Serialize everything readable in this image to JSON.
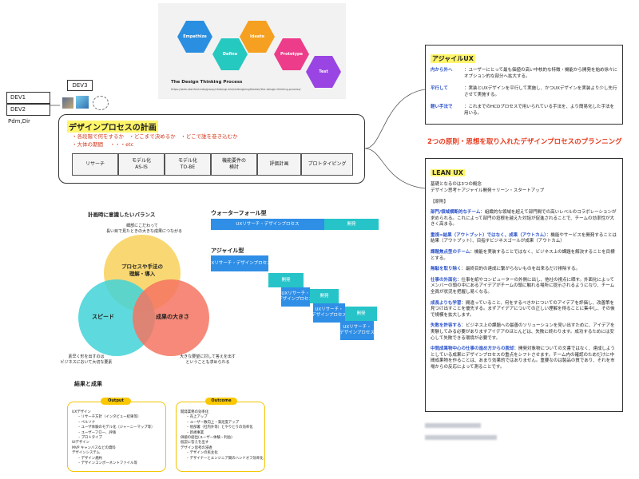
{
  "design_thinking": {
    "stages": [
      "Empathize",
      "Define",
      "Ideate",
      "Prototype",
      "Test"
    ],
    "caption": "The Design Thinking Process",
    "url": "https://web.stanford.edu/group/cilab/cgi-bin/redesigningtheater/the-design-thinking-process/"
  },
  "devs": {
    "dev1": "DEV1",
    "dev2": "DEV2",
    "dev3": "DEV3",
    "pdm": "Pdm,Dir"
  },
  "plan": {
    "title": "デザインプロセスの計画",
    "note1": "・各段階で何をするか　・どこまで決めるか　・どこで誰を巻き込むか",
    "note2": "・大体の期間　 ・・・etc",
    "steps": [
      "リサーチ",
      "モデル化\nAS-IS",
      "モデル化\nTO-BE",
      "機能要件の\n検討",
      "評価計画",
      "プロトタイピング"
    ]
  },
  "balance": {
    "title": "計画時に意識したいバランス",
    "top_note": "細部にこだわって\n長い目で見たときの大きな成果につながる",
    "circle_top": "プロセスや手法の\n理解・導入",
    "circle_left": "スピード",
    "circle_right": "成果の大きさ",
    "note_left": "素早く形を出すのは\nビジネスにおいて大切な要素",
    "note_right": "大きな要望に対して答えを出す\nということも求められる"
  },
  "waterfall": {
    "title": "ウォーターフォール型",
    "bar1": "UXリサーチ・デザインプロセス",
    "bar2": "開発"
  },
  "agile": {
    "title": "アジャイル型",
    "bars": [
      "UXリサーチ・デザインプロセス",
      "開発",
      "UXリサーチ・\nデザインプロセス",
      "開発",
      "UXリサーチ・\nデザインプロセス",
      "開発",
      "UXリサーチ・\nデザインプロセス"
    ]
  },
  "results": {
    "title": "結果と成果",
    "output_label": "Output",
    "outcome_label": "Outcome",
    "output_items": [
      "UXデザイン",
      "– リサーチ方針（インタビュー結果等）",
      "– ペルソナ",
      "– ユーザ体験のモデル化（ジャーニーマップ等）",
      "– ユーザーフロー、評価",
      "– プロトタイプ",
      "UIデザイン",
      "MVP キャンバスなどの資料",
      "デザインシステム",
      "– デザイン規約",
      "– デザインコンポーネントファイル等"
    ],
    "outcome_items": [
      "開発業務の効率化",
      "– 売上アップ",
      "– ユーザー数向上・満足度アップ",
      "– 他部署（社内外等）とやりとりの効率化",
      "– 新規事業",
      "価値の創出(ユーザー体験・利益)",
      "仮説に答えを出す",
      "デザイン思考の浸透",
      "– デザインの民主化",
      "– デザイナーとエンジニア間のハンドオフ効率化"
    ]
  },
  "agile_ux": {
    "title": "アジャイルUX",
    "rows": [
      {
        "key": "内から外へ",
        "text": "ユーザーにとって最も価値の高い中核的な特徴・機能から開発を始め徐々にオプション的な部分へ拡大する。"
      },
      {
        "key": "平行して",
        "text": "実装とUXデザインを平行して実施し、かつUXデザインを実装より少し先行させて実施する。"
      },
      {
        "key": "軽い手法で",
        "text": "これまでのHCDプロセスで用いられている手法を、より簡易化した手法を用いる。"
      }
    ]
  },
  "center_title": "2つの原則・思想を取り入れたデザインプロセスのプランニング",
  "lean_ux": {
    "title": "LEAN UX",
    "intro1": "基礎となるのは3つの概念",
    "intro2": "デザイン思考＋アジャイル開発＋リーン・スタートアップ",
    "principles_label": "【原則】",
    "rows": [
      {
        "key": "部門/領域横断的なチーム",
        "text": "：組織的な領域を超えて部門間での高いレベルのコラボレーションが求められる。これによって部門の垣根を越えた対話が促進されることで、チームの効率性が大きく高まる。"
      },
      {
        "key": "重視=結果（アウトプット）ではなく、成果（アウトカム）",
        "text": "：機能やサービスを開発することは結果（アウトプット）、目指すビジネスゴールが成果（アウトカム）"
      },
      {
        "key": "課題焦点型のチーム",
        "text": "：機能を実装することではなく、ビジネス上の課題を解決することを目標とする。"
      },
      {
        "key": "無駄を取り除く",
        "text": "：最終目的の達成に繋がらないものを出来るだけ排除する。"
      },
      {
        "key": "仕事の外面化",
        "text": "：仕事を紙やコンピューターの外側に出し、他社の視点に晒す。外面化によってメンバーの頭の中にあるアイデアがチームの頭に触れる場所に提示されるようになり、チーム全員が状況を把握し易くなる。"
      },
      {
        "key": "成長よりも学習",
        "text": "：間違っていること、何をするべきかについてのアイデアを評価し、改善策を見つけ出すことを優先する。まずアイデアについての正しい理解を得ることに集中し、その後で規模を拡大します。"
      },
      {
        "key": "失敗を許容する",
        "text": "：ビジネス上の課題への最善のソリューションを見い出すために、アイデアを実験してみる必要がありますアイデアのほとんどは、失敗に終わります。成功するためには安心して失敗できる環境が必要です。"
      },
      {
        "key": "中間成果物中心の仕事の進め方からの脱却",
        "text": "：開発対象物についての文書ではなく、達成しようとしている成果にデザインプロセスの重点をシフトさせます。チーム内の確認のためだけに中間成果物を作ることは、あまり効果的ではありません。重要なのは製品の質であり、それを市場からの反応によって測ることです。"
      }
    ]
  },
  "colors": {
    "highlight": "#fff56b",
    "accent_red": "#e8391d",
    "link_blue": "#2b52c9",
    "bar_blue": "#2f8ee6",
    "bar_teal": "#26c4c9",
    "venn_yellow": "#f8d15a",
    "venn_teal": "#42d4d8",
    "venn_coral": "#f57461"
  }
}
